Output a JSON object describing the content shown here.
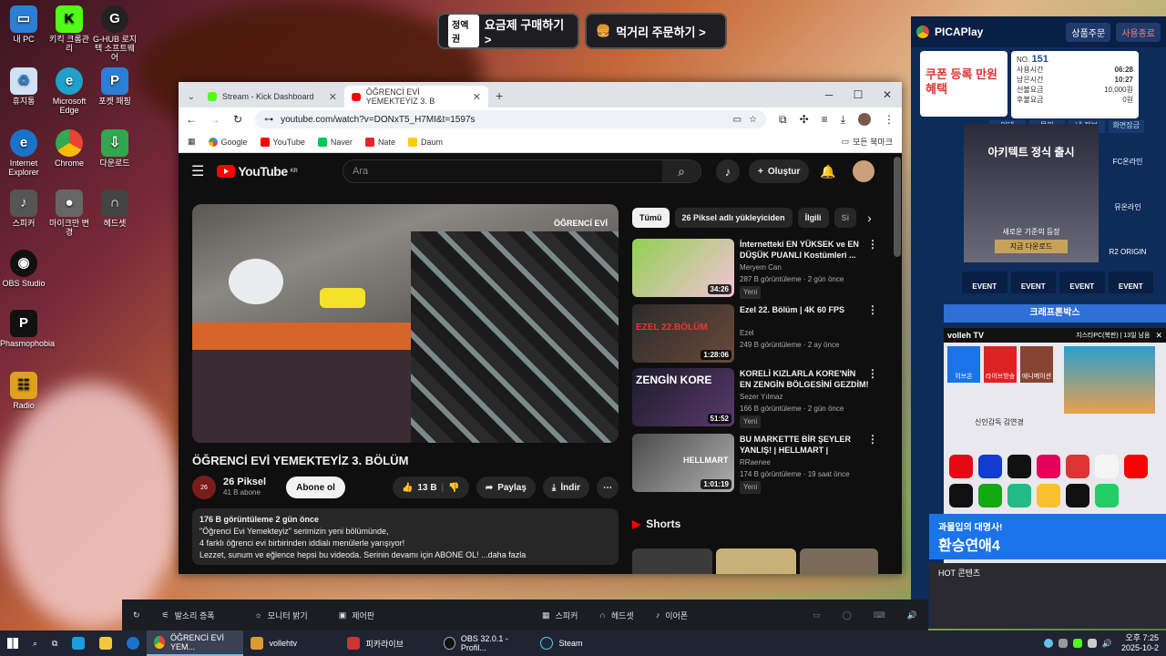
{
  "desktop": {
    "icons": [
      "내 PC",
      "키킥 크롬관리",
      "G-HUB 로지텍 소프트웨어",
      "휴지통",
      "Microsoft Edge",
      "포켓 패핑",
      "Internet Explorer",
      "Chrome",
      "다운로드",
      "스피커",
      "마이크만 변경",
      "헤드셋",
      "OBS Studio",
      "Phasmophobia",
      "Radio"
    ]
  },
  "banner": {
    "btn1_badge": "정액권",
    "btn1": "요금제 구매하기 >",
    "btn2": "먹거리 주문하기 >"
  },
  "picaplay": {
    "brand": "PICAPlay",
    "order": "상품주문",
    "logout": "사용종료",
    "promo": "쿠폰 등록 만원 혜택",
    "seat_label": "NO.",
    "seat": "151",
    "used_label": "사용시간",
    "used": "06:28",
    "remain_label": "남은시간",
    "remain": "10:27",
    "amount_label": "선불요금",
    "amount": "10,000원",
    "paid_label": "후불요금",
    "paid": "0원",
    "menu": [
      "인대",
      "문의",
      "내 정보",
      "화면잠금"
    ],
    "game_ad_title": "아키텍트 정식 출시",
    "game_ad_sub": "새로운 기준의 등장",
    "game_ad_btn": "지금 다운로드",
    "side_games": [
      "FC온라인",
      "뮤온라인",
      "R2 ORIGIN"
    ],
    "events": [
      "EVENT",
      "EVENT",
      "EVENT",
      "EVENT"
    ],
    "krafton": "크래프톤박스",
    "volleh": "volleh TV",
    "volleh_info": "지스타PC(북판) | 13일 남음",
    "tv_items": [
      "이브온",
      "라이브방송",
      "애니메이션"
    ],
    "news": "신인감독 김연경",
    "banner2_a": "과몰입의 대명사!",
    "banner2_b": "환승연애4",
    "hot": "HOT 콘텐츠"
  },
  "chrome": {
    "tab1": "Stream - Kick Dashboard",
    "tab2": "ÖĞRENCİ EVİ YEMEKTEYİZ 3. B",
    "url": "youtube.com/watch?v=DONxT5_H7MI&t=1597s",
    "bookmarks": [
      "Google",
      "YouTube",
      "Naver",
      "Nate",
      "Daum"
    ],
    "all_bookmarks": "모든 북마크"
  },
  "youtube": {
    "logo": "YouTube",
    "region": "KR",
    "search_placeholder": "Ara",
    "create": "Oluştur",
    "title": "ÖĞRENCİ EVİ YEMEKTEYİZ 3. BÖLÜM",
    "channel": "26 Piksel",
    "subs": "41 B abone",
    "subscribe": "Abone ol",
    "likes": "13 B",
    "share": "Paylaş",
    "download": "İndir",
    "views_line": "176 B görüntüleme  2 gün önce",
    "desc1": "\"Öğrenci Evi Yemekteyiz\" serimizin yeni bölümünde,",
    "desc2": "4 farklı öğrenci evi birbirinden iddialı menülerle yarışıyor!",
    "desc3": "Lezzet, sunum ve eğlence hepsi bu videoda. Serinin devamı için ABONE OL! ...daha fazla",
    "watermark": "ÖĞRENCİ EVİ",
    "chips": [
      "Tümü",
      "26 Piksel adlı yükleyiciden",
      "İlgili",
      "Si"
    ],
    "shorts": "Shorts",
    "recs": [
      {
        "title": "İnternetteki EN YÜKSEK  ve EN DÜŞÜK PUANLI Kostümleri ...",
        "channel": "Meryem Can",
        "meta": "287 B görüntüleme · 2 gün önce",
        "badge": "Yeni",
        "duration": "34:26"
      },
      {
        "title": "Ezel 22. Bölüm | 4K 60 FPS",
        "channel": "Ezel",
        "meta": "249 B görüntüleme · 2 ay önce",
        "badge": "",
        "duration": "1:28:06"
      },
      {
        "title": "KORELİ KIZLARLA KORE'NİN EN ZENGİN BÖLGESİNİ GEZDİM!",
        "channel": "Sezer Yılmaz",
        "meta": "166 B görüntüleme · 2 gün önce",
        "badge": "Yeni",
        "duration": "51:52"
      },
      {
        "title": "BU MARKETTE BİR ŞEYLER YANLIŞ! | HELLMART |",
        "channel": "RRaenee",
        "meta": "174 B görüntüleme · 19 saat önce",
        "badge": "Yeni",
        "duration": "1:01:19"
      }
    ],
    "thumb_labels": [
      "",
      "EZEL 22.BÖLÜM",
      "ZENGİN KORE",
      "HELLMART"
    ]
  },
  "pc_toolbar": [
    "발소리 증폭",
    "모니터 밝기",
    "제어판",
    "스피커",
    "헤드셋",
    "이어폰"
  ],
  "taskbar": {
    "apps": [
      "ÖĞRENCİ EVİ YEM...",
      "vollehtv",
      "피카라이브",
      "OBS 32.0.1 - Profil...",
      "Steam"
    ],
    "time": "오후 7:25",
    "date": "2025-10-2"
  },
  "colors": {
    "yt_bg": "#0f0f0f",
    "yt_red": "#ff0000",
    "taskbar": "#1e2432",
    "pica_blue": "#0e2c5a"
  }
}
